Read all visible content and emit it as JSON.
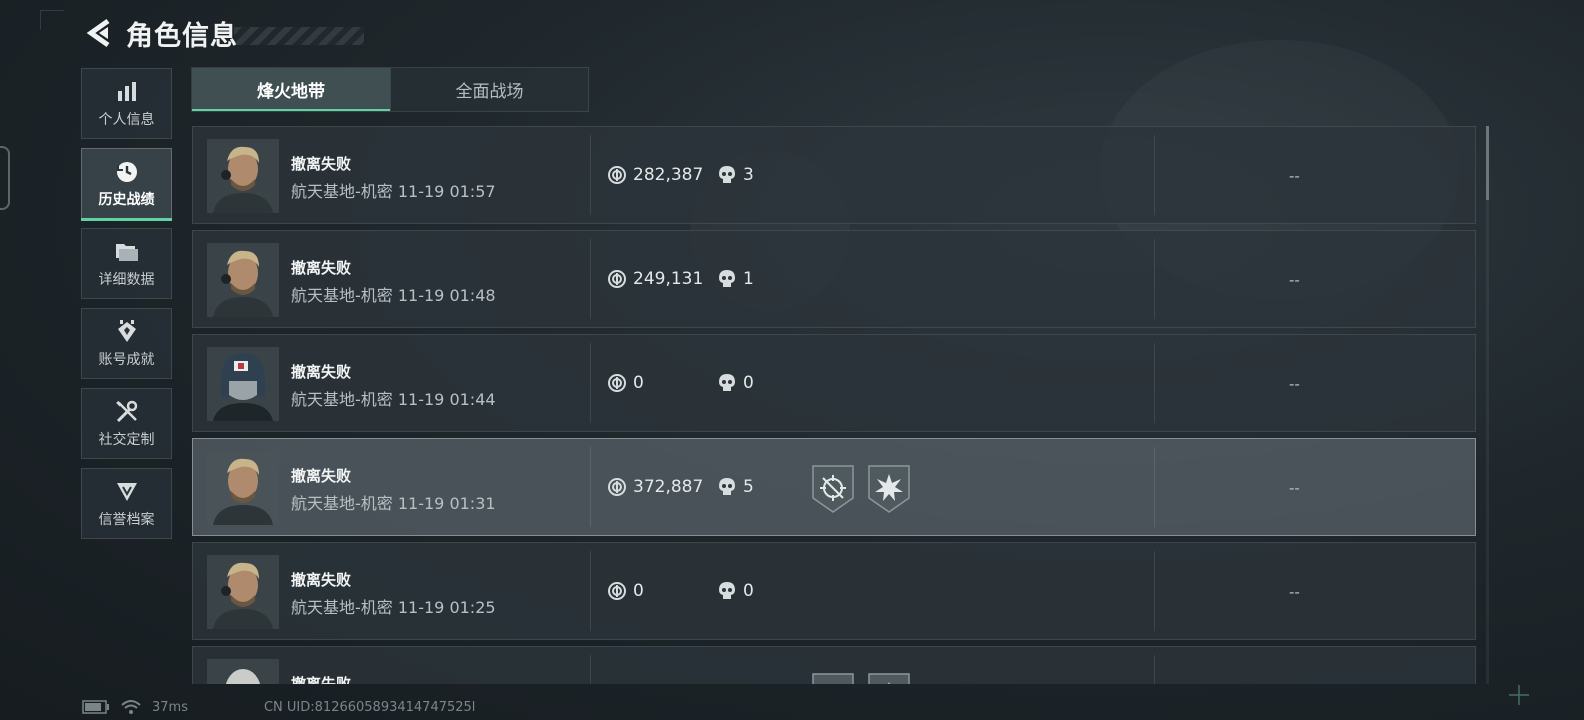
{
  "header": {
    "title": "角色信息"
  },
  "sidebar": {
    "items": [
      {
        "label": "个人信息",
        "icon": "bar-chart-icon",
        "active": false
      },
      {
        "label": "历史战绩",
        "icon": "history-icon",
        "active": true
      },
      {
        "label": "详细数据",
        "icon": "folders-icon",
        "active": false
      },
      {
        "label": "账号成就",
        "icon": "achievement-icon",
        "active": false
      },
      {
        "label": "社交定制",
        "icon": "tools-icon",
        "active": false
      },
      {
        "label": "信誉档案",
        "icon": "reputation-icon",
        "active": false
      }
    ]
  },
  "tabs": [
    {
      "label": "烽火地带",
      "active": true
    },
    {
      "label": "全面战场",
      "active": false
    }
  ],
  "records": [
    {
      "result": "撤离失败",
      "detail": "航天基地-机密 11-19 01:57",
      "value": "282,387",
      "kills": "3",
      "extra": "--",
      "avatar": "blond-operator",
      "badges": []
    },
    {
      "result": "撤离失败",
      "detail": "航天基地-机密 11-19 01:48",
      "value": "249,131",
      "kills": "1",
      "extra": "--",
      "avatar": "blond-operator",
      "badges": []
    },
    {
      "result": "撤离失败",
      "detail": "航天基地-机密 11-19 01:44",
      "value": "0",
      "kills": "0",
      "extra": "--",
      "avatar": "helmet-operator",
      "badges": []
    },
    {
      "result": "撤离失败",
      "detail": "航天基地-机密 11-19 01:31",
      "value": "372,887",
      "kills": "5",
      "extra": "--",
      "avatar": "blond-operator",
      "badges": [
        "crosshair-badge-icon",
        "explosion-badge-icon"
      ],
      "highlight": true
    },
    {
      "result": "撤离失败",
      "detail": "航天基地-机密 11-19 01:25",
      "value": "0",
      "kills": "0",
      "extra": "--",
      "avatar": "blond-operator",
      "badges": []
    },
    {
      "result": "撤离失败",
      "detail": "",
      "value": "",
      "kills": "",
      "extra": "",
      "avatar": "grey-hair-operator",
      "badges": [
        "crosshair-badge-icon",
        "explosion-badge-icon"
      ]
    }
  ],
  "footer": {
    "ping": "37ms",
    "uid": "CN UID:8126605893414747525l"
  },
  "colors": {
    "accent": "#5fd3a3",
    "panel": "#2c353b",
    "text": "#e6e9ea"
  }
}
